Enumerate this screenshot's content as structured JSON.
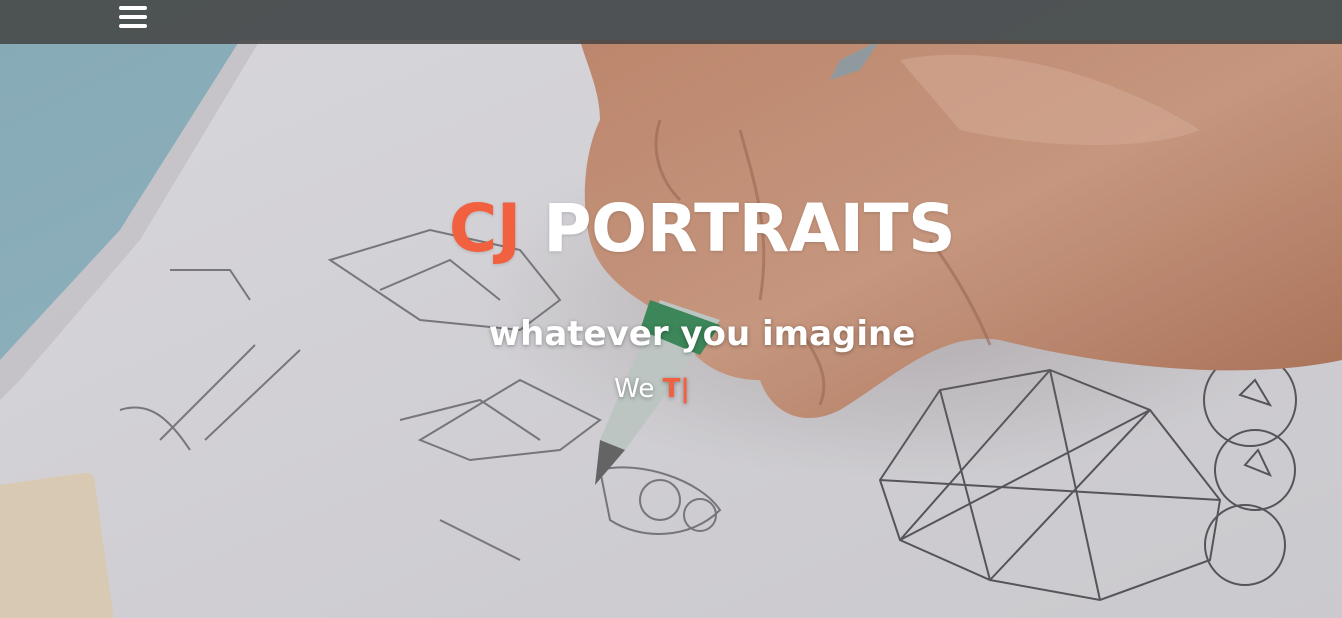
{
  "nav": {
    "menu_icon": "hamburger-menu-icon"
  },
  "hero": {
    "title_accent": "CJ",
    "title_main": "PORTRAITS",
    "tagline": "whatever you imagine",
    "typer_prefix": "We",
    "typer_typed": "T",
    "typer_cursor": "|"
  },
  "colors": {
    "accent": "#f2613f",
    "text": "#ffffff",
    "topbar": "#464646"
  }
}
